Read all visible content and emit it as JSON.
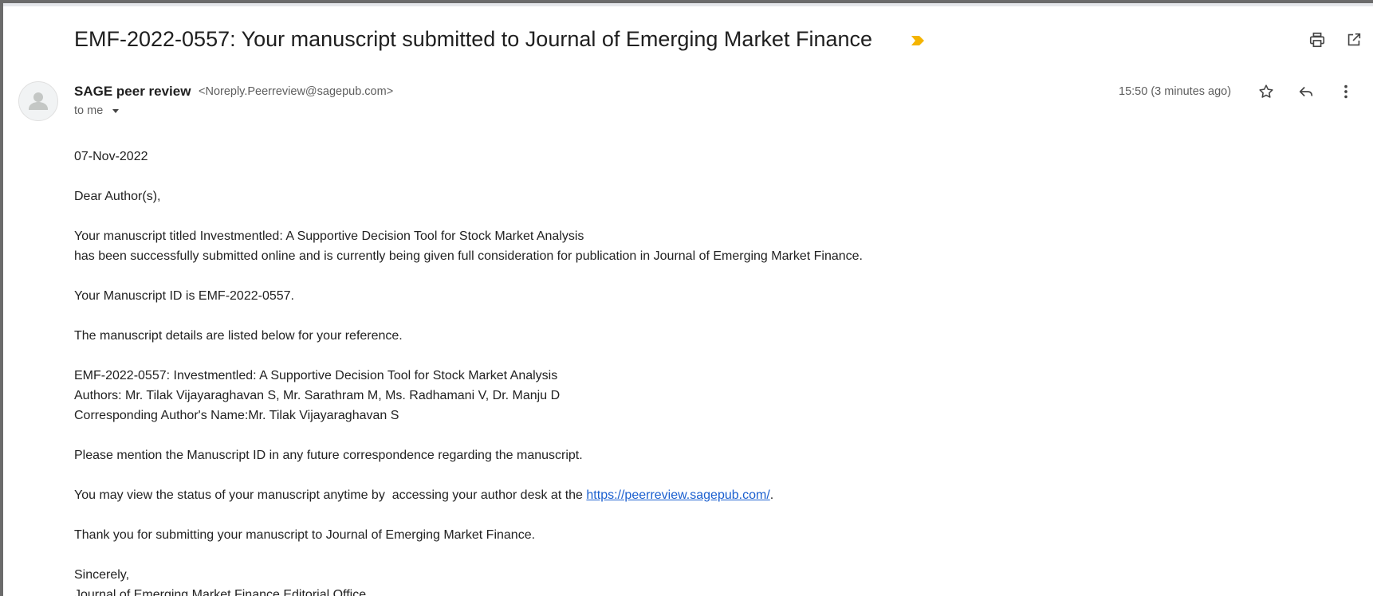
{
  "message": {
    "subject": "EMF-2022-0557: Your manuscript submitted to Journal of Emerging Market Finance",
    "sender": {
      "name": "SAGE peer review",
      "email": "<Noreply.Peerreview@sagepub.com>"
    },
    "recipient_label": "to me",
    "timestamp": "15:50 (3 minutes ago)",
    "icons": {
      "important": "important-marker-icon",
      "print": "print-icon",
      "open_new_window": "open-in-new-window-icon",
      "star": "star-icon",
      "reply": "reply-icon",
      "more": "more-vertical-icon",
      "avatar": "person-icon",
      "dropdown": "chevron-down-icon"
    },
    "colors": {
      "important_marker": "#f4b400",
      "link": "#1a5fcf",
      "text": "#222222",
      "muted": "#5e5e5e"
    }
  },
  "body": {
    "date": "07-Nov-2022",
    "greeting": "Dear Author(s),",
    "para1_line1": "Your manuscript titled Investmentled: A Supportive Decision Tool for Stock Market Analysis",
    "para1_line2": "has been successfully submitted online and is currently being given full consideration for publication in Journal of Emerging Market Finance.",
    "manuscript_id_line": "Your Manuscript ID is EMF-2022-0557.",
    "details_intro": "The manuscript details are listed below for your reference.",
    "details_title": "EMF-2022-0557: Investmentled: A Supportive Decision Tool for Stock Market Analysis",
    "details_authors": "Authors: Mr. Tilak Vijayaraghavan S, Mr. Sarathram M, Ms. Radhamani V, Dr. Manju D",
    "details_corresponding": "Corresponding Author's Name:Mr. Tilak Vijayaraghavan S",
    "mention_id": "Please mention the Manuscript ID in any future correspondence regarding the manuscript.",
    "status_prefix": "You may view the status of your manuscript anytime by  accessing your author desk at the ",
    "status_link": "https://peerreview.sagepub.com/",
    "status_suffix": ".",
    "thanks": "Thank you for submitting your manuscript to Journal of Emerging Market Finance.",
    "closing": "Sincerely,",
    "signature": "Journal of Emerging Market Finance Editorial Office"
  }
}
